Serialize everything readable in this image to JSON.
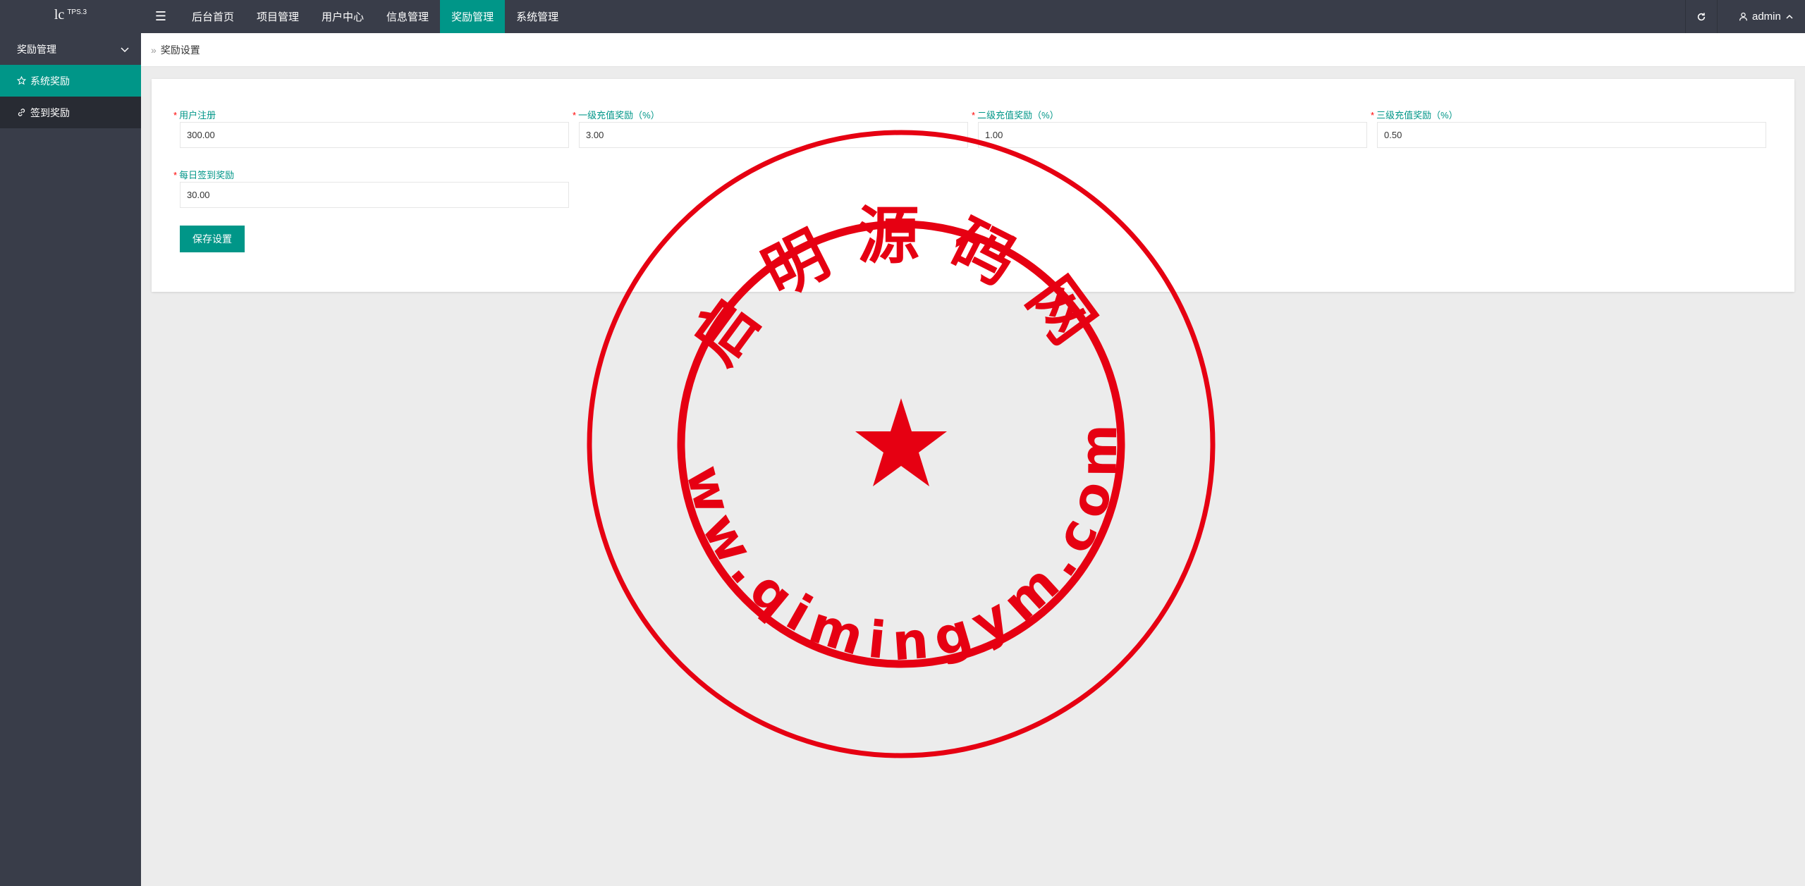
{
  "app": {
    "logo_main": "lc",
    "logo_sup": "TPS.3"
  },
  "topbar": {
    "menu_toggle_glyph": "☰",
    "nav": [
      {
        "label": "后台首页",
        "active": false
      },
      {
        "label": "项目管理",
        "active": false
      },
      {
        "label": "用户中心",
        "active": false
      },
      {
        "label": "信息管理",
        "active": false
      },
      {
        "label": "奖励管理",
        "active": true
      },
      {
        "label": "系统管理",
        "active": false
      }
    ],
    "refresh_icon": "refresh-icon",
    "user": "admin"
  },
  "sidebar": {
    "group": {
      "label": "奖励管理",
      "icon": "chevron-down-icon"
    },
    "items": [
      {
        "label": "系统奖励",
        "icon": "star-icon",
        "active": true
      },
      {
        "label": "签到奖励",
        "icon": "link-icon",
        "active": false
      }
    ]
  },
  "breadcrumb": {
    "sep": "»",
    "current": "奖励设置"
  },
  "form": {
    "fields": [
      {
        "label": "用户注册",
        "value": "300.00"
      },
      {
        "label": "一级充值奖励（%）",
        "value": "3.00"
      },
      {
        "label": "二级充值奖励（%）",
        "value": "1.00"
      },
      {
        "label": "三级充值奖励（%）",
        "value": "0.50"
      },
      {
        "label": "每日签到奖励",
        "value": "30.00"
      }
    ],
    "required_mark": "*",
    "save_label": "保存设置"
  },
  "watermark": {
    "top_text": "启明源码网",
    "bottom_text": "www.qimingym.com",
    "color": "#e60012"
  },
  "colors": {
    "accent": "#009688",
    "topbar": "#393d49",
    "required": "#ff0000"
  }
}
